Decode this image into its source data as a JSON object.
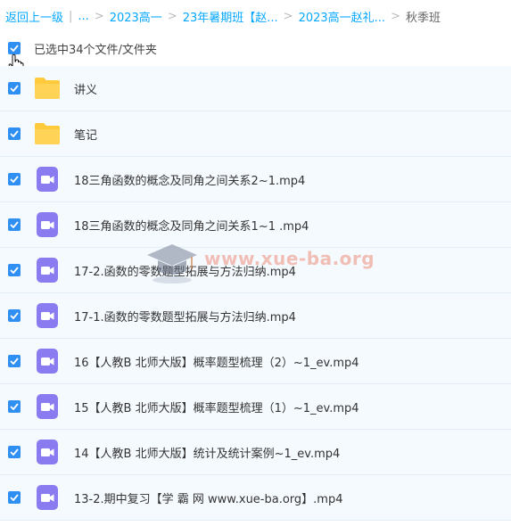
{
  "breadcrumb": {
    "back": "返回上一级",
    "ellipsis": "...",
    "crumbs": [
      "2023高一",
      "23年暑期班【赵...",
      "2023高一赵礼..."
    ],
    "current": "秋季班",
    "separator": ">"
  },
  "selection": {
    "text": "已选中34个文件/文件夹",
    "checked": true
  },
  "files": [
    {
      "name": "讲义",
      "type": "folder"
    },
    {
      "name": "笔记",
      "type": "folder"
    },
    {
      "name": "18三角函数的概念及同角之间关系2~1.mp4",
      "type": "video"
    },
    {
      "name": "18三角函数的概念及同角之间关系1~1 .mp4",
      "type": "video"
    },
    {
      "name": "17-2.函数的零数题型拓展与方法归纳.mp4",
      "type": "video"
    },
    {
      "name": "17-1.函数的零数题型拓展与方法归纳.mp4",
      "type": "video"
    },
    {
      "name": "16【人教B 北师大版】概率题型梳理（2）~1_ev.mp4",
      "type": "video"
    },
    {
      "name": "15【人教B 北师大版】概率题型梳理（1）~1_ev.mp4",
      "type": "video"
    },
    {
      "name": "14【人教B 北师大版】统计及统计案例~1_ev.mp4",
      "type": "video"
    },
    {
      "name": "13-2.期中复习【学 霸 网 www.xue-ba.org】.mp4",
      "type": "video"
    }
  ],
  "watermark": {
    "text": "www.xue-ba.org"
  },
  "colors": {
    "accent": "#06a7ff",
    "checkbox": "#2f8ff2",
    "folder": "#ffcb3d",
    "video": "#8a7cf0",
    "row_bg": "#f5faff"
  }
}
